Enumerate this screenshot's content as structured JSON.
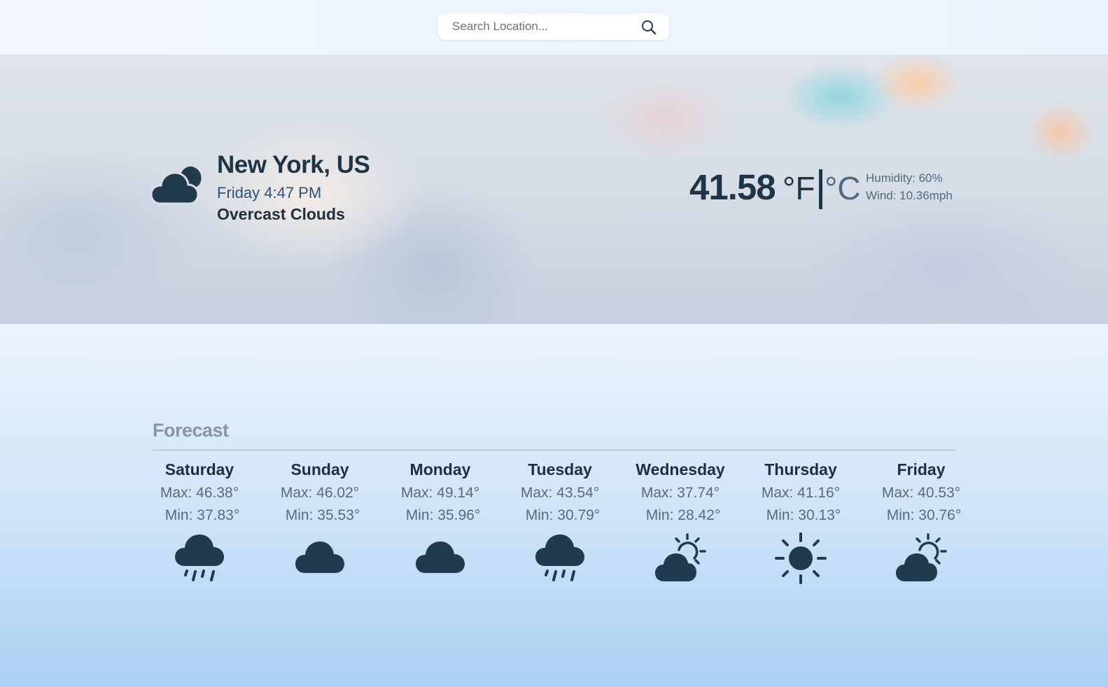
{
  "search": {
    "placeholder": "Search Location...",
    "icon": "search-icon"
  },
  "current": {
    "icon": "cloudy-icon",
    "city": "New York, US",
    "datetime": "Friday 4:47 PM",
    "description": "Overcast Clouds",
    "temperature": "41.58",
    "unit_f": "°F",
    "unit_c": "°C",
    "active_unit": "F",
    "humidity": "Humidity: 60%",
    "wind": "Wind: 10.36mph"
  },
  "forecast": {
    "title": "Forecast",
    "days": [
      {
        "day": "Saturday",
        "max": "Max: 46.38°",
        "min": "Min: 37.83°",
        "icon": "rain-icon"
      },
      {
        "day": "Sunday",
        "max": "Max: 46.02°",
        "min": "Min: 35.53°",
        "icon": "cloud-icon"
      },
      {
        "day": "Monday",
        "max": "Max: 49.14°",
        "min": "Min: 35.96°",
        "icon": "cloud-icon"
      },
      {
        "day": "Tuesday",
        "max": "Max: 43.54°",
        "min": "Min: 30.79°",
        "icon": "rain-icon"
      },
      {
        "day": "Wednesday",
        "max": "Max: 37.74°",
        "min": "Min: 28.42°",
        "icon": "partly-cloudy-icon"
      },
      {
        "day": "Thursday",
        "max": "Max: 41.16°",
        "min": "Min: 30.13°",
        "icon": "sun-icon"
      },
      {
        "day": "Friday",
        "max": "Max: 40.53°",
        "min": "Min: 30.76°",
        "icon": "partly-cloudy-icon"
      }
    ]
  },
  "colors": {
    "icon": "#223a4e",
    "heading": "#1f3547",
    "muted": "#5a6a78"
  }
}
